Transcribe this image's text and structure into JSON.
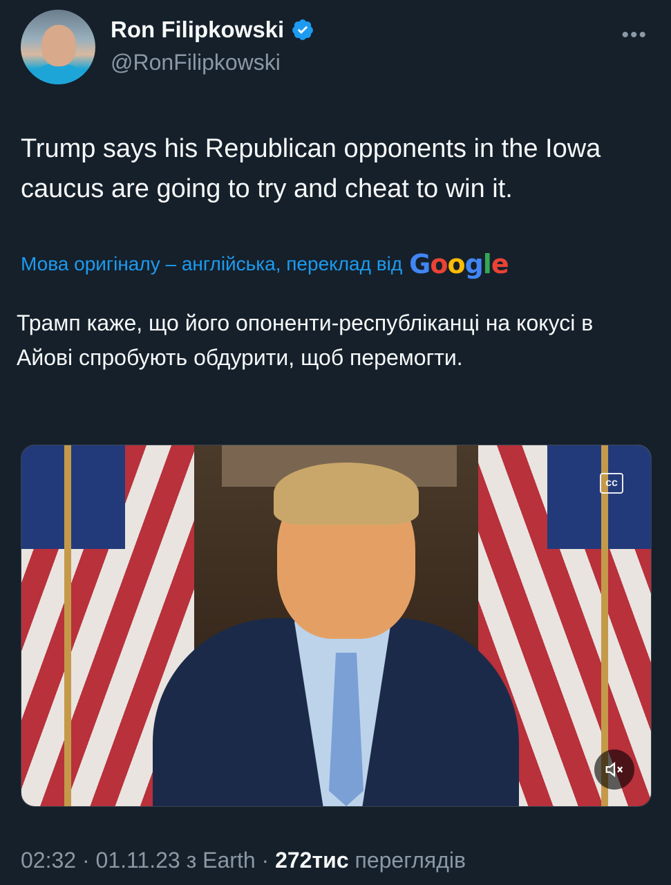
{
  "author": {
    "name": "Ron Filipkowski",
    "handle": "@RonFilipkowski",
    "verified": true,
    "verified_color": "#1d9bf0"
  },
  "tweet": {
    "text": "Trump says his Republican opponents in the Iowa caucus are going to try and cheat to win it.",
    "translation_note": "Мова оригіналу – англійська, переклад від",
    "translation_provider": "Google",
    "translation": "Трамп каже, що його опоненти-республіканці на кокусі в Айові спробують обдурити, щоб перемогти."
  },
  "media": {
    "type": "video",
    "cc_icon": "captions-icon",
    "mute_icon": "mute-icon"
  },
  "meta": {
    "time": "02:32",
    "date": "01.11.23",
    "source": "з Earth",
    "views_count": "272тис",
    "views_label": "переглядів",
    "separator": "·"
  },
  "colors": {
    "background": "#15202b",
    "text": "#f7f9f9",
    "secondary": "#8b98a5",
    "accent": "#1d9bf0"
  }
}
